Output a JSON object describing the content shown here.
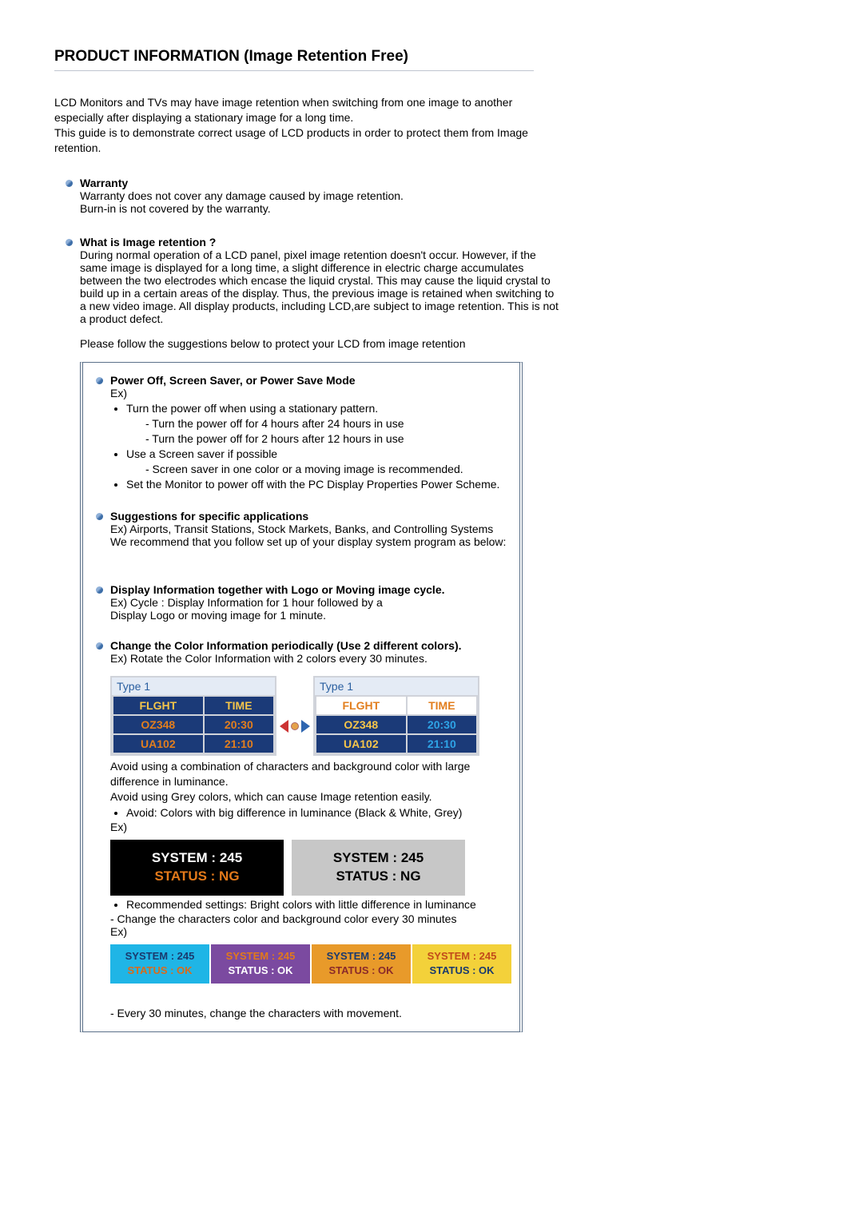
{
  "title": "PRODUCT INFORMATION (Image Retention Free)",
  "intro": {
    "p1": "LCD Monitors and TVs may have image retention when switching from one image to another especially after displaying a stationary image for a long time.",
    "p2": "This guide is to demonstrate correct usage of LCD products in order to protect them from Image retention."
  },
  "warranty": {
    "heading": "Warranty",
    "line1": "Warranty does not cover any damage caused by image retention.",
    "line2": "Burn-in is not covered by the warranty."
  },
  "what_is": {
    "heading": "What is Image retention ?",
    "body": "During normal operation of a LCD panel, pixel image retention doesn't occur. However, if the same image is displayed for a long time, a slight difference in electric charge accumulates between the two electrodes which encase the liquid crystal. This may cause the liquid crystal to build up in a certain areas of the display. Thus, the previous image is retained when switching to a new video image. All display products, including LCD,are subject to image retention. This is not a product defect."
  },
  "follow": "Please follow the suggestions below to protect your LCD from image retention",
  "framed": {
    "s1": {
      "heading": "Power Off, Screen Saver, or Power Save Mode",
      "ex": "Ex)",
      "li1": "Turn the power off when using a stationary pattern.",
      "li1a": "- Turn the power off for 4 hours after 24 hours in use",
      "li1b": "- Turn the power off for 2 hours after 12 hours in use",
      "li2": "Use a Screen saver if possible",
      "li2a": "- Screen saver in one color or a moving image is recommended.",
      "li3": "Set the Monitor to power off with the PC Display Properties Power Scheme."
    },
    "s2": {
      "heading": "Suggestions for specific applications",
      "line1": "Ex) Airports, Transit Stations, Stock Markets, Banks, and Controlling Systems",
      "line2": "We recommend that you follow set up of your display system program as below:"
    },
    "s3": {
      "heading": "Display Information together with Logo or Moving image cycle.",
      "line1": "Ex) Cycle : Display Information for 1 hour followed by a",
      "line2": "Display Logo or moving image for 1 minute."
    },
    "s4": {
      "heading": "Change the Color Information periodically (Use 2 different colors).",
      "line1": "Ex) Rotate the Color Information with 2 colors every 30 minutes.",
      "table_left": {
        "type_hdr": "Type 1",
        "cols": [
          "FLGHT",
          "TIME"
        ],
        "rows": [
          [
            "OZ348",
            "20:30"
          ],
          [
            "UA102",
            "21:10"
          ]
        ]
      },
      "table_right": {
        "type_hdr": "Type 1",
        "cols": [
          "FLGHT",
          "TIME"
        ],
        "rows": [
          [
            "OZ348",
            "20:30"
          ],
          [
            "UA102",
            "21:10"
          ]
        ]
      },
      "after1": "Avoid using a combination of characters and background color with large difference in luminance.",
      "after2": "Avoid using Grey colors, which can cause Image retention easily.",
      "avoid_li": "Avoid: Colors with big difference in luminance (Black & White, Grey)",
      "ex_label": "Ex)",
      "status_black": {
        "l1": "SYSTEM : 245",
        "l2": "STATUS : NG"
      },
      "status_grey": {
        "l1": "SYSTEM : 245",
        "l2": "STATUS : NG"
      },
      "rec_li": "Recommended settings: Bright colors with little difference in luminance",
      "rec_sub": "- Change the characters color and background color every 30 minutes",
      "rec_boxes": {
        "b1": {
          "l1": "SYSTEM : 245",
          "l2": "STATUS : OK"
        },
        "b2": {
          "l1": "SYSTEM : 245",
          "l2": "STATUS : OK"
        },
        "b3": {
          "l1": "SYSTEM : 245",
          "l2": "STATUS : OK"
        },
        "b4": {
          "l1": "SYSTEM : 245",
          "l2": "STATUS : OK"
        }
      },
      "last": "- Every 30 minutes, change the characters with movement."
    }
  }
}
